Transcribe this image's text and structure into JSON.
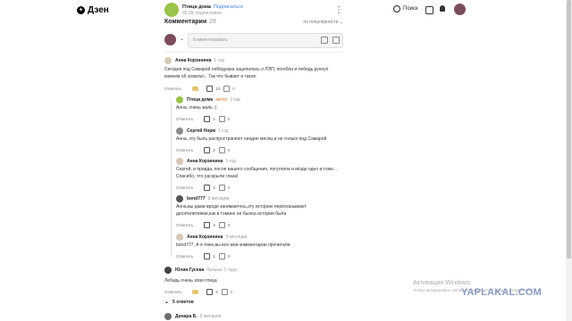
{
  "topbar": {
    "logo_text": "Дзен",
    "channel_name": "Птица дома",
    "subscribe": "Подписаться",
    "subscribers": "35,2K подписчиков",
    "more": "⋮",
    "search": "Поиск"
  },
  "comments_header": {
    "title": "Комментарии",
    "count": "28",
    "sort": "по популярности ⌄"
  },
  "composer": {
    "placeholder": "Комментировать"
  },
  "comments": [
    {
      "name": "Анна Корзинина",
      "badge": "",
      "time": "1 год",
      "text": "Сегодня под Самарой лебёдушка зацепилась о ЛЭП, погибла и лебедь рухнул камнем об асвальт... Так что бывает и такое.",
      "reply": "Ответить",
      "likes": "12",
      "dislikes": "0"
    },
    {
      "name": "Птица дома",
      "badge": "автор",
      "time": "1 год",
      "text": "Анна, очень жаль :(",
      "reply": "Ответить",
      "likes": "4",
      "dislikes": "0"
    },
    {
      "name": "Сергей Норм",
      "badge": "",
      "time": "1 год",
      "text": "Анна, эту быль распространяют неодин месяц и не только под Самарой",
      "reply": "Ответить",
      "likes": "2",
      "dislikes": "0"
    },
    {
      "name": "Анна Корзинина",
      "badge": "",
      "time": "1 год",
      "text": "Сергей, и правда, после вашего сообщения, погуглила и вёзде одно и тоже... Спасибо, что раскрыли глаза!",
      "reply": "Ответить",
      "likes": "4",
      "dislikes": "0"
    },
    {
      "name": "bond777",
      "badge": "",
      "time": "9 месяцев",
      "text": "Анна,вы дама вроде занимаетесь,эту историю пересказывают десятилетиями,как в томине не былоа история была",
      "reply": "Ответить",
      "likes": "3",
      "dislikes": "0"
    },
    {
      "name": "Анна Корзинина",
      "badge": "",
      "time": "9 месяцев",
      "text": "bond777, А я тоже,вы все мои комментарии прочитали.",
      "reply": "Ответить",
      "likes": "1",
      "dislikes": "0"
    },
    {
      "name": "Юлия Гусева",
      "badge": "",
      "time": "больше 1 года",
      "text": "Лебедь очень злая птица",
      "reply": "Ответить",
      "likes": "4",
      "dislikes": "0"
    },
    {
      "name": "Динара Б.",
      "badge": "",
      "time": "9 месяцев",
      "text": "",
      "reply": "",
      "likes": "",
      "dislikes": ""
    }
  ],
  "replies_toggle": "5 ответов",
  "system": {
    "activate_title": "Активация Windows",
    "activate_sub": "Чтобы активировать Windows, перейдите в раздел \"Параметры\".",
    "watermark": "YAPLAKAL.COM"
  }
}
